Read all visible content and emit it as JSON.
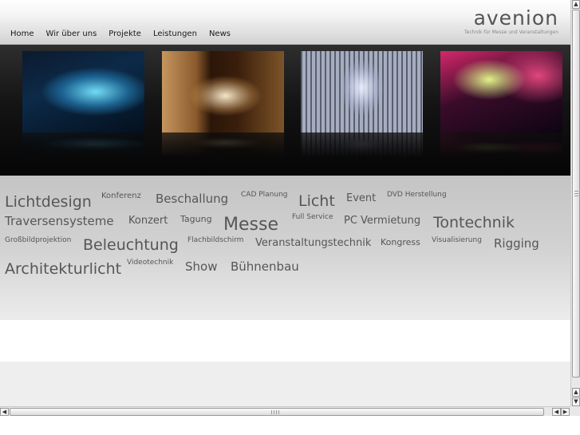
{
  "nav": {
    "items": [
      "Home",
      "Wir über uns",
      "Projekte",
      "Leistungen",
      "News"
    ]
  },
  "logo": {
    "wordmark": "avenion",
    "tagline": "Technik für Messe und Veranstaltungen"
  },
  "photos": [
    {
      "icon": "glass-building-photo"
    },
    {
      "icon": "exhibition-room-photo"
    },
    {
      "icon": "atrium-hall-photo"
    },
    {
      "icon": "concert-stage-photo"
    }
  ],
  "tag_cloud": {
    "tags": [
      "Lichtdesign",
      "Konferenz",
      "Beschallung",
      "CAD Planung",
      "Licht",
      "Event",
      "DVD Herstellung",
      "Traversensysteme",
      "Konzert",
      "Tagung",
      "Messe",
      "Full Service",
      "PC Vermietung",
      "Tontechnik",
      "Großbildprojektion",
      "Beleuchtung",
      "Flachbildschirm",
      "Veranstaltungstechnik",
      "Kongress",
      "Visualisierung",
      "Rigging",
      "Architekturlicht",
      "Videotechnik",
      "Show",
      "Bühnenbau"
    ]
  },
  "scrollbars": {
    "up_arrow": "▲",
    "down_arrow": "▼",
    "left_arrow": "◀",
    "right_arrow": "▶"
  },
  "colors": {
    "tag_text": "#565656",
    "nav_text": "#1a1a1a",
    "logo_text": "#555555"
  }
}
